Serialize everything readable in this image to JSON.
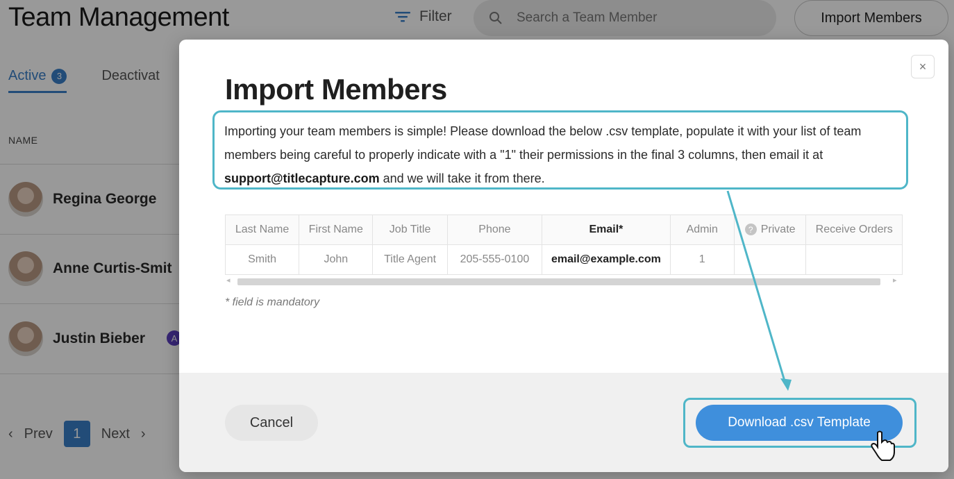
{
  "page": {
    "title": "Team Management",
    "filter_label": "Filter",
    "search_placeholder": "Search a Team Member",
    "import_button": "Import Members",
    "tabs": [
      {
        "label": "Active",
        "count": "3"
      },
      {
        "label": "Deactivat"
      }
    ],
    "column_name": "NAME",
    "members": [
      {
        "name": "Regina George"
      },
      {
        "name": "Anne Curtis-Smit"
      },
      {
        "name": "Justin Bieber",
        "badge": "A"
      }
    ],
    "pagination": {
      "prev": "Prev",
      "current": "1",
      "next": "Next"
    }
  },
  "modal": {
    "title": "Import Members",
    "close_symbol": "×",
    "description_before": "Importing your team members is simple! Please download the below .csv template, populate it with your list of team members being careful to properly indicate with a \"1\" their permissions in the final 3 columns, then email it at ",
    "support_email": "support@titlecapture.com",
    "description_after": " and we will take it from there.",
    "template": {
      "headers": [
        "Last Name",
        "First Name",
        "Job Title",
        "Phone",
        "Email*",
        "Admin",
        "Private",
        "Receive Orders"
      ],
      "row": [
        "Smith",
        "John",
        "Title Agent",
        "205-555-0100",
        "email@example.com",
        "1",
        "",
        ""
      ]
    },
    "mandatory_note": "* field is mandatory",
    "cancel_button": "Cancel",
    "download_button": "Download .csv Template"
  },
  "colors": {
    "accent_blue": "#3a7fc9",
    "download_blue": "#3f8fdc",
    "highlight_teal": "#4fb6c8"
  }
}
